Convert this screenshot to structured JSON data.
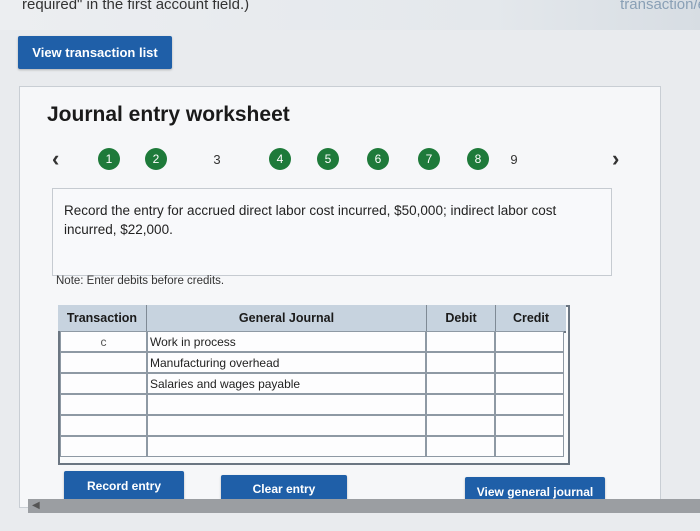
{
  "header": {
    "cut_off_text": "required\" in the first account field.)",
    "cut_off_right": "transaction/e"
  },
  "view_list_button": "View transaction list",
  "worksheet": {
    "title": "Journal entry worksheet",
    "steps": [
      "1",
      "2",
      "3",
      "4",
      "5",
      "6",
      "7",
      "8",
      "9"
    ],
    "current_step": "3",
    "instruction": "Record the entry for accrued direct labor cost incurred, $50,000; indirect labor cost incurred, $22,000.",
    "note": "Note: Enter debits before credits."
  },
  "table": {
    "headers": [
      "Transaction",
      "General Journal",
      "Debit",
      "Credit"
    ],
    "rows": [
      {
        "transaction": "c",
        "account": "Work in process",
        "debit": "",
        "credit": ""
      },
      {
        "transaction": "",
        "account": "Manufacturing overhead",
        "debit": "",
        "credit": ""
      },
      {
        "transaction": "",
        "account": "Salaries and wages payable",
        "debit": "",
        "credit": ""
      },
      {
        "transaction": "",
        "account": "",
        "debit": "",
        "credit": ""
      },
      {
        "transaction": "",
        "account": "",
        "debit": "",
        "credit": ""
      },
      {
        "transaction": "",
        "account": "",
        "debit": "",
        "credit": ""
      }
    ]
  },
  "buttons": {
    "record": "Record entry",
    "clear": "Clear entry",
    "view_journal": "View general journal"
  },
  "colors": {
    "accent_blue": "#1f5fa8",
    "step_green": "#1e7a3a",
    "header_fill": "#c7d3df"
  },
  "icons": {
    "prev": "chevron-left-icon",
    "next": "chevron-right-icon"
  }
}
